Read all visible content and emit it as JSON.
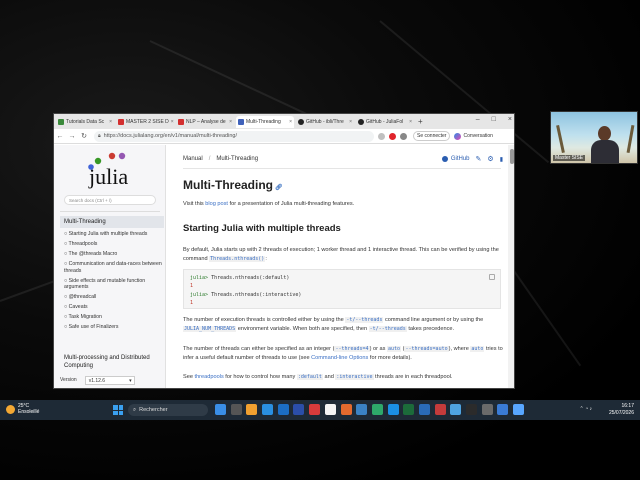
{
  "browser": {
    "tabs": [
      {
        "label": "Tutorials Data Sc",
        "color": "#3a8a3a"
      },
      {
        "label": "MASTER 2 SISE D",
        "color": "#d32f2f"
      },
      {
        "label": "NLP – Analyse de",
        "color": "#d32f2f"
      },
      {
        "label": "Multi-Threading",
        "color": "#4062bb"
      },
      {
        "label": "GitHub - ibli/Thre",
        "color": "#222222"
      },
      {
        "label": "GitHub - JuliaFol",
        "color": "#222222"
      }
    ],
    "new_tab": "+",
    "window_controls": [
      "–",
      "□",
      "×"
    ],
    "url": "https://docs.julialang.org/en/v1/manual/multi-threading/",
    "signin_label": "Se connecter",
    "conversation_label": "Conversation"
  },
  "sidebar": {
    "search_placeholder": "Search docs (Ctrl + /)",
    "section": "Multi-Threading",
    "items": [
      "Starting Julia with multiple threads",
      "Threadpools",
      "The @threads Macro",
      "Communication and data-races between threads",
      "Side effects and mutable function arguments",
      "@threadcall",
      "Caveats",
      "Task Migration",
      "Safe use of Finalizers"
    ],
    "next_section": "Multi-processing and Distributed Computing",
    "version_label": "Version",
    "version_value": "v1.12.6"
  },
  "page": {
    "breadcrumb_manual": "Manual",
    "breadcrumb_sep": "/",
    "breadcrumb_current": "Multi-Threading",
    "github_label": "GitHub",
    "title": "Multi-Threading",
    "intro_pre": "Visit this ",
    "intro_link": "blog post",
    "intro_post": " for a presentation of Julia multi-threading features.",
    "h2": "Starting Julia with multiple threads",
    "p1_pre": "By default, Julia starts up with 2 threads of execution; 1 worker thread and 1 interactive thread. This can be verified by using the command ",
    "p1_code": "Threads.nthreads()",
    "p1_post": ":",
    "code_lines": [
      {
        "prompt": "julia>",
        "text": " Threads.nthreads(:default)"
      },
      {
        "out": "1"
      },
      {
        "prompt": "julia>",
        "text": " Threads.nthreads(:interactive)"
      },
      {
        "out": "1"
      }
    ],
    "p2_a": "The number of execution threads is controlled either by using the ",
    "p2_code1": "-t/--threads",
    "p2_b": " command line argument or by using the ",
    "p2_code2": "JULIA_NUM_THREADS",
    "p2_c": " environment variable. When both are specified, then ",
    "p2_code3": "-t/--threads",
    "p2_d": " takes precedence.",
    "p3_a": "The number of threads can either be specified as an integer (",
    "p3_code1": "--threads=4",
    "p3_b": ") or as ",
    "p3_code2": "auto",
    "p3_c": " (",
    "p3_code3": "--threads=auto",
    "p3_d": "), where ",
    "p3_code4": "auto",
    "p3_e": " tries to infer a useful default number of threads to use (see ",
    "p3_link": "Command-line Options",
    "p3_f": " for more details).",
    "p4_a": "See ",
    "p4_link": "threadpools",
    "p4_b": " for how to control how many ",
    "p4_code1": ":default",
    "p4_c": " and ",
    "p4_code2": ":interactive",
    "p4_d": " threads are in each threadpool."
  },
  "webcam": {
    "label": "Master SISE"
  },
  "taskbar": {
    "temperature": "25°C",
    "weather": "Ensoleillé",
    "search_label": "Rechercher",
    "time": "16:17",
    "date": "25/07/2026",
    "app_colors": [
      "#3a8ee6",
      "#555555",
      "#f0a030",
      "#2a8fe0",
      "#1c6ec4",
      "#2b4ea8",
      "#d83b3b",
      "#f3f3f3",
      "#e36a2e",
      "#3b82c4",
      "#2ea86a",
      "#1b8fe3",
      "#1c6b3a",
      "#2a6bb8",
      "#c43b3b",
      "#4fa3e0",
      "#2b2b2b",
      "#6a6a6a",
      "#3a7bd5",
      "#58a6ff"
    ]
  }
}
